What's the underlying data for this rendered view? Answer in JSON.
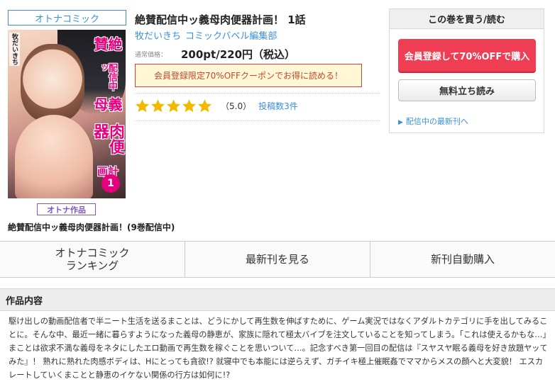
{
  "product": {
    "category_tag": "オトナコミック",
    "title": "絶賛配信中ッ義母肉便器計画！ 1話",
    "author": "牧だいきち",
    "publisher": "コミックバベル編集部",
    "price_label": "通常価格：",
    "price": "200pt/220円（税込）",
    "coupon_text": "会員登録限定70%OFFクーポンでお得に読める！",
    "rating": {
      "stars": 5,
      "score_text": "（5.0）",
      "review_link": "投稿数3件"
    },
    "adult_badge": "オトナ作品",
    "series_title": "絶賛配信中ッ義母肉便器計画！(9巻配信中)"
  },
  "cover": {
    "title_lines": [
      "絶賛",
      "配信中ッ",
      "義母",
      "肉便器",
      "計画！"
    ],
    "author": "牧だいきち",
    "volume": "1"
  },
  "buy_panel": {
    "header": "この巻を買う/読む",
    "signup_button": "会員登録して70%OFFで購入",
    "trial_button": "無料立ち読み",
    "latest_link": "配信中の最新刊へ"
  },
  "actions": [
    {
      "label_line1": "オトナコミック",
      "label_line2": "ランキング"
    },
    {
      "label_line1": "最新刊を見る",
      "label_line2": ""
    },
    {
      "label_line1": "新刊自動購入",
      "label_line2": ""
    }
  ],
  "synopsis": {
    "header": "作品内容",
    "text": "駆け出しの動画配信者で半ニート生活を送るまことは、どうにかして再生数を伸ばすために、ゲーム実況ではなくアダルトカテゴリに手を出してみることに。そんな中、最近一緒に暮らすようになった義母の静恵が、家族に隠れて極太バイブを注文していることを知ってしまう。「これは使えるかもな…」まことは欲求不満な義母をネタにしたエロ動画で再生数を稼ぐことを思いついて…。記念すべき第一回目の配信は『スヤスヤ眠る義母を好き放題ヤッてみた』！ 熟れに熟れた肉感ボディは、Hにとっても貪欲!? 就寝中でも本能には逆らえず、ガチイキ極上催眠姦でママからメスの顔へと大変貌！ エスカレートしていくまことと静恵のイケない関係の行方は如何に!?"
  },
  "colors": {
    "accent_blue": "#3a8fd9",
    "signup_red": "#ef3d54",
    "star_yellow": "#f5b800",
    "adult_purple": "#7e57c2"
  }
}
